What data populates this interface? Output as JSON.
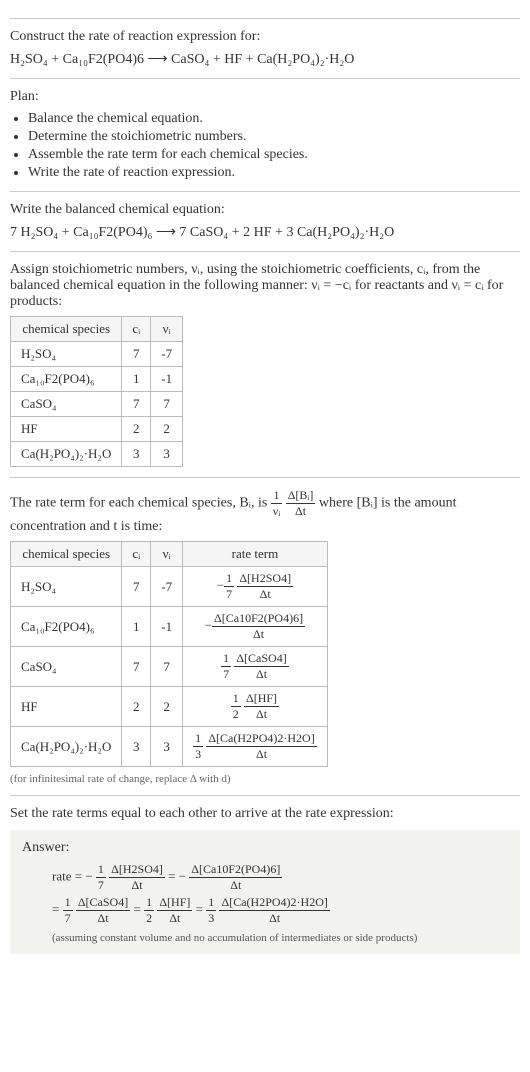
{
  "s1": {
    "heading": "Construct the rate of reaction expression for:",
    "eq": "H₂SO₄ + Ca₁₀F2(PO4)6 ⟶ CaSO₄ + HF + Ca(H₂PO₄)₂·H₂O"
  },
  "plan": {
    "heading": "Plan:",
    "items": [
      "Balance the chemical equation.",
      "Determine the stoichiometric numbers.",
      "Assemble the rate term for each chemical species.",
      "Write the rate of reaction expression."
    ]
  },
  "balanced": {
    "heading": "Write the balanced chemical equation:",
    "eq": "7 H₂SO₄ + Ca₁₀F2(PO4)₆ ⟶ 7 CaSO₄ + 2 HF + 3 Ca(H₂PO₄)₂·H₂O"
  },
  "stoich": {
    "intro": "Assign stoichiometric numbers, νᵢ, using the stoichiometric coefficients, cᵢ, from the balanced chemical equation in the following manner: νᵢ = −cᵢ for reactants and νᵢ = cᵢ for products:",
    "headers": [
      "chemical species",
      "cᵢ",
      "νᵢ"
    ],
    "rows": [
      [
        "H₂SO₄",
        "7",
        "-7"
      ],
      [
        "Ca₁₀F2(PO4)₆",
        "1",
        "-1"
      ],
      [
        "CaSO₄",
        "7",
        "7"
      ],
      [
        "HF",
        "2",
        "2"
      ],
      [
        "Ca(H₂PO₄)₂·H₂O",
        "3",
        "3"
      ]
    ]
  },
  "rateterm": {
    "intro_pre": "The rate term for each chemical species, Bᵢ, is ",
    "intro_post": " where [Bᵢ] is the amount concentration and t is time:",
    "frac1_num": "1",
    "frac1_den": "νᵢ",
    "frac2_num": "Δ[Bᵢ]",
    "frac2_den": "Δt",
    "headers": [
      "chemical species",
      "cᵢ",
      "νᵢ",
      "rate term"
    ],
    "rows": [
      {
        "sp": "H₂SO₄",
        "c": "7",
        "v": "-7",
        "sign": "−",
        "coef_num": "1",
        "coef_den": "7",
        "d_num": "Δ[H2SO4]",
        "d_den": "Δt"
      },
      {
        "sp": "Ca₁₀F2(PO4)₆",
        "c": "1",
        "v": "-1",
        "sign": "−",
        "coef_num": "",
        "coef_den": "",
        "d_num": "Δ[Ca10F2(PO4)6]",
        "d_den": "Δt"
      },
      {
        "sp": "CaSO₄",
        "c": "7",
        "v": "7",
        "sign": "",
        "coef_num": "1",
        "coef_den": "7",
        "d_num": "Δ[CaSO4]",
        "d_den": "Δt"
      },
      {
        "sp": "HF",
        "c": "2",
        "v": "2",
        "sign": "",
        "coef_num": "1",
        "coef_den": "2",
        "d_num": "Δ[HF]",
        "d_den": "Δt"
      },
      {
        "sp": "Ca(H₂PO₄)₂·H₂O",
        "c": "3",
        "v": "3",
        "sign": "",
        "coef_num": "1",
        "coef_den": "3",
        "d_num": "Δ[Ca(H2PO4)2·H2O]",
        "d_den": "Δt"
      }
    ],
    "note": "(for infinitesimal rate of change, replace Δ with d)"
  },
  "final": {
    "heading": "Set the rate terms equal to each other to arrive at the rate expression:",
    "answer_label": "Answer:",
    "line1_pre": "rate = −",
    "t1_cn": "1",
    "t1_cd": "7",
    "t1_dn": "Δ[H2SO4]",
    "t1_dd": "Δt",
    "eq1": " = −",
    "t2_dn": "Δ[Ca10F2(PO4)6]",
    "t2_dd": "Δt",
    "line2_pre": " = ",
    "t3_cn": "1",
    "t3_cd": "7",
    "t3_dn": "Δ[CaSO4]",
    "t3_dd": "Δt",
    "eq2": " = ",
    "t4_cn": "1",
    "t4_cd": "2",
    "t4_dn": "Δ[HF]",
    "t4_dd": "Δt",
    "eq3": " = ",
    "t5_cn": "1",
    "t5_cd": "3",
    "t5_dn": "Δ[Ca(H2PO4)2·H2O]",
    "t5_dd": "Δt",
    "note": "(assuming constant volume and no accumulation of intermediates or side products)"
  }
}
